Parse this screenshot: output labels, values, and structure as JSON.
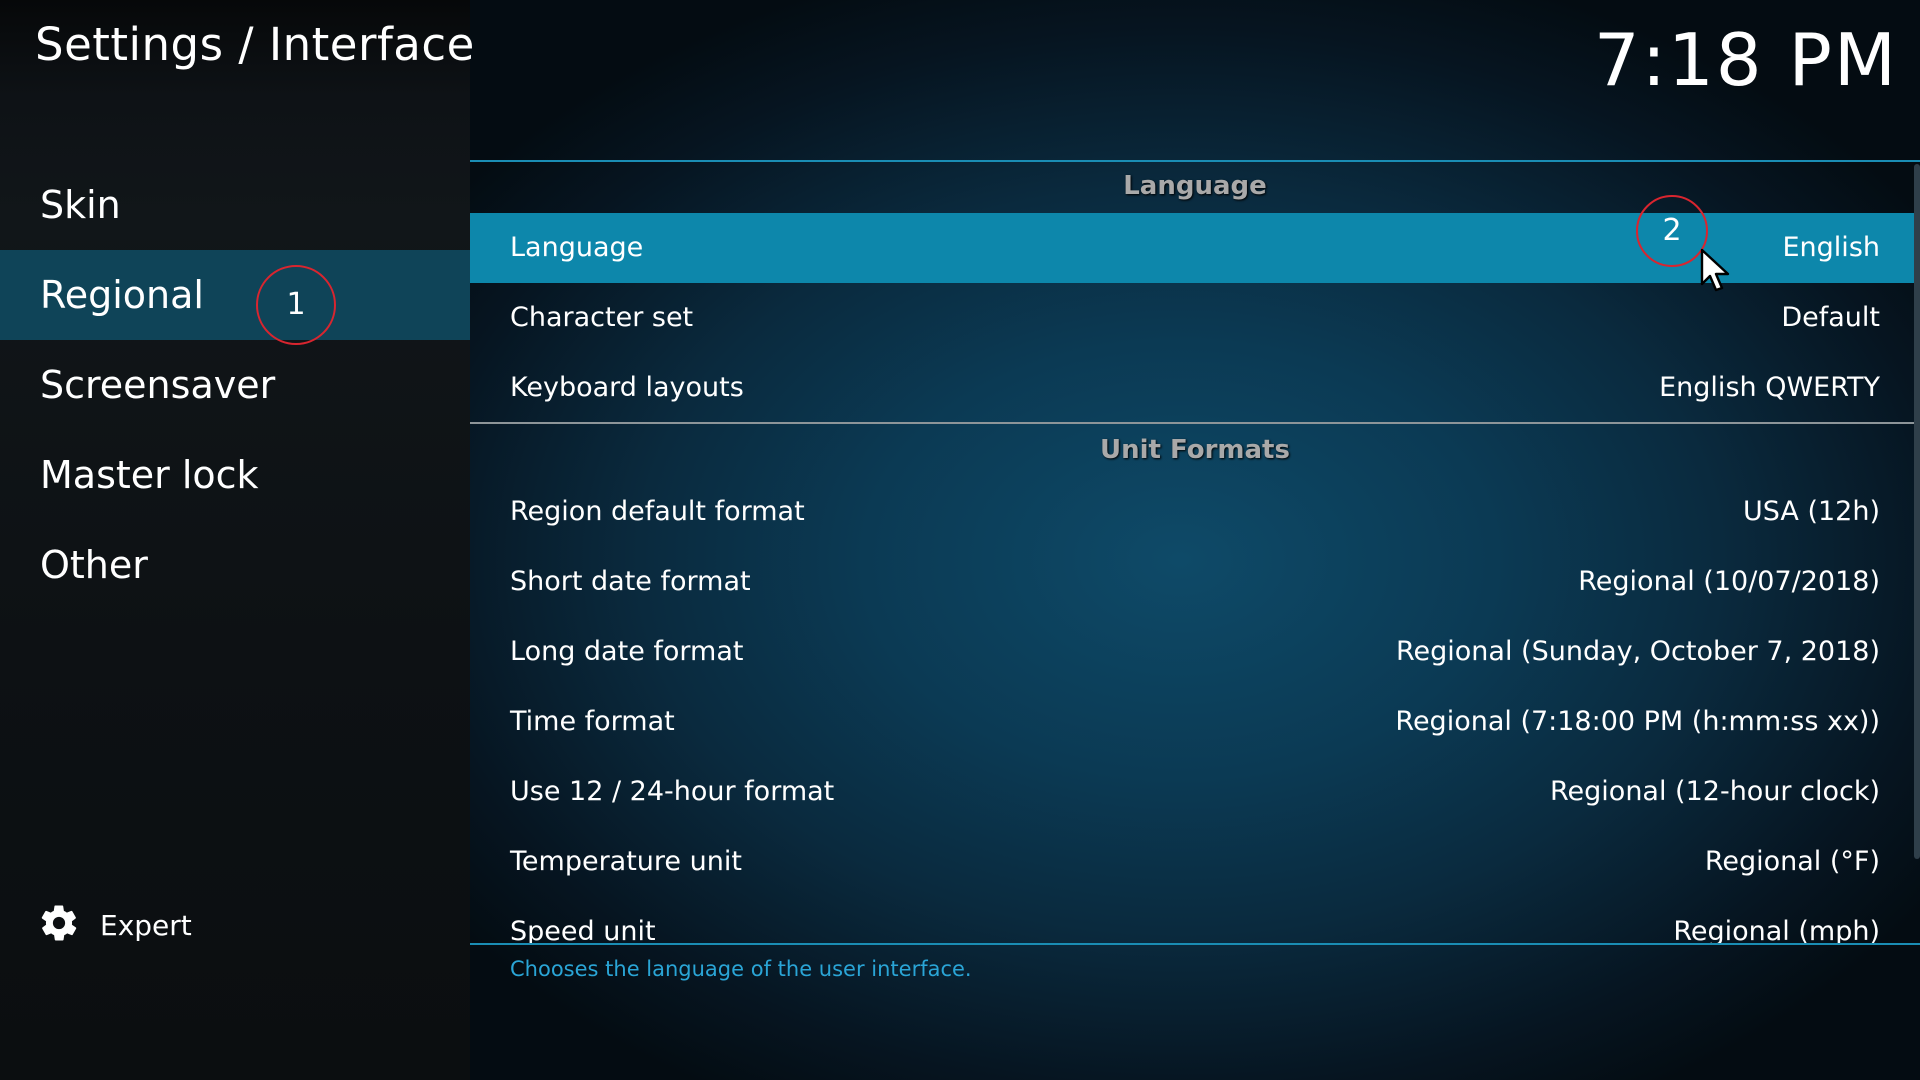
{
  "header": {
    "title": "Settings / Interface",
    "clock": "7:18 PM"
  },
  "sidebar": {
    "items": [
      {
        "label": "Skin"
      },
      {
        "label": "Regional",
        "active": true
      },
      {
        "label": "Screensaver"
      },
      {
        "label": "Master lock"
      },
      {
        "label": "Other"
      }
    ],
    "expert_label": "Expert",
    "expert_icon": "gear-icon"
  },
  "sections": [
    {
      "header": "Language",
      "rows": [
        {
          "label": "Language",
          "value": "English",
          "selected": true
        },
        {
          "label": "Character set",
          "value": "Default"
        },
        {
          "label": "Keyboard layouts",
          "value": "English QWERTY"
        }
      ]
    },
    {
      "header": "Unit Formats",
      "rows": [
        {
          "label": "Region default format",
          "value": "USA (12h)"
        },
        {
          "label": "Short date format",
          "value": "Regional (10/07/2018)"
        },
        {
          "label": "Long date format",
          "value": "Regional (Sunday, October 7, 2018)"
        },
        {
          "label": "Time format",
          "value": "Regional (7:18:00 PM (h:mm:ss xx))"
        },
        {
          "label": "Use 12 / 24-hour format",
          "value": "Regional (12-hour clock)"
        },
        {
          "label": "Temperature unit",
          "value": "Regional (°F)"
        },
        {
          "label": "Speed unit",
          "value": "Regional (mph)"
        }
      ]
    }
  ],
  "description": "Chooses the language of the user interface.",
  "annotations": {
    "marker_1": "1",
    "marker_2": "2"
  },
  "colors": {
    "selected_row": "#0d87ab",
    "active_nav": "#0f4458",
    "accent_line": "#1a8db4",
    "description_text": "#2aa5d6",
    "annotation": "#d9252f"
  }
}
